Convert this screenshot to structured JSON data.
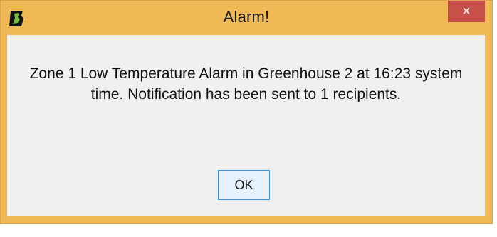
{
  "window": {
    "title": "Alarm!",
    "close_glyph": "×",
    "app_icon": "greenhouse-app-icon"
  },
  "dialog": {
    "message": "Zone 1 Low Temperature Alarm in Greenhouse 2 at 16:23 system time. Notification has been sent to 1 recipients.",
    "ok_label": "OK"
  },
  "colors": {
    "frame": "#f0b956",
    "close_button": "#c7504a",
    "client_bg": "#f0f0f0",
    "ok_button_bg": "#e5f1fb",
    "ok_button_border": "#3c8fd6",
    "icon_green": "#7cc242"
  }
}
